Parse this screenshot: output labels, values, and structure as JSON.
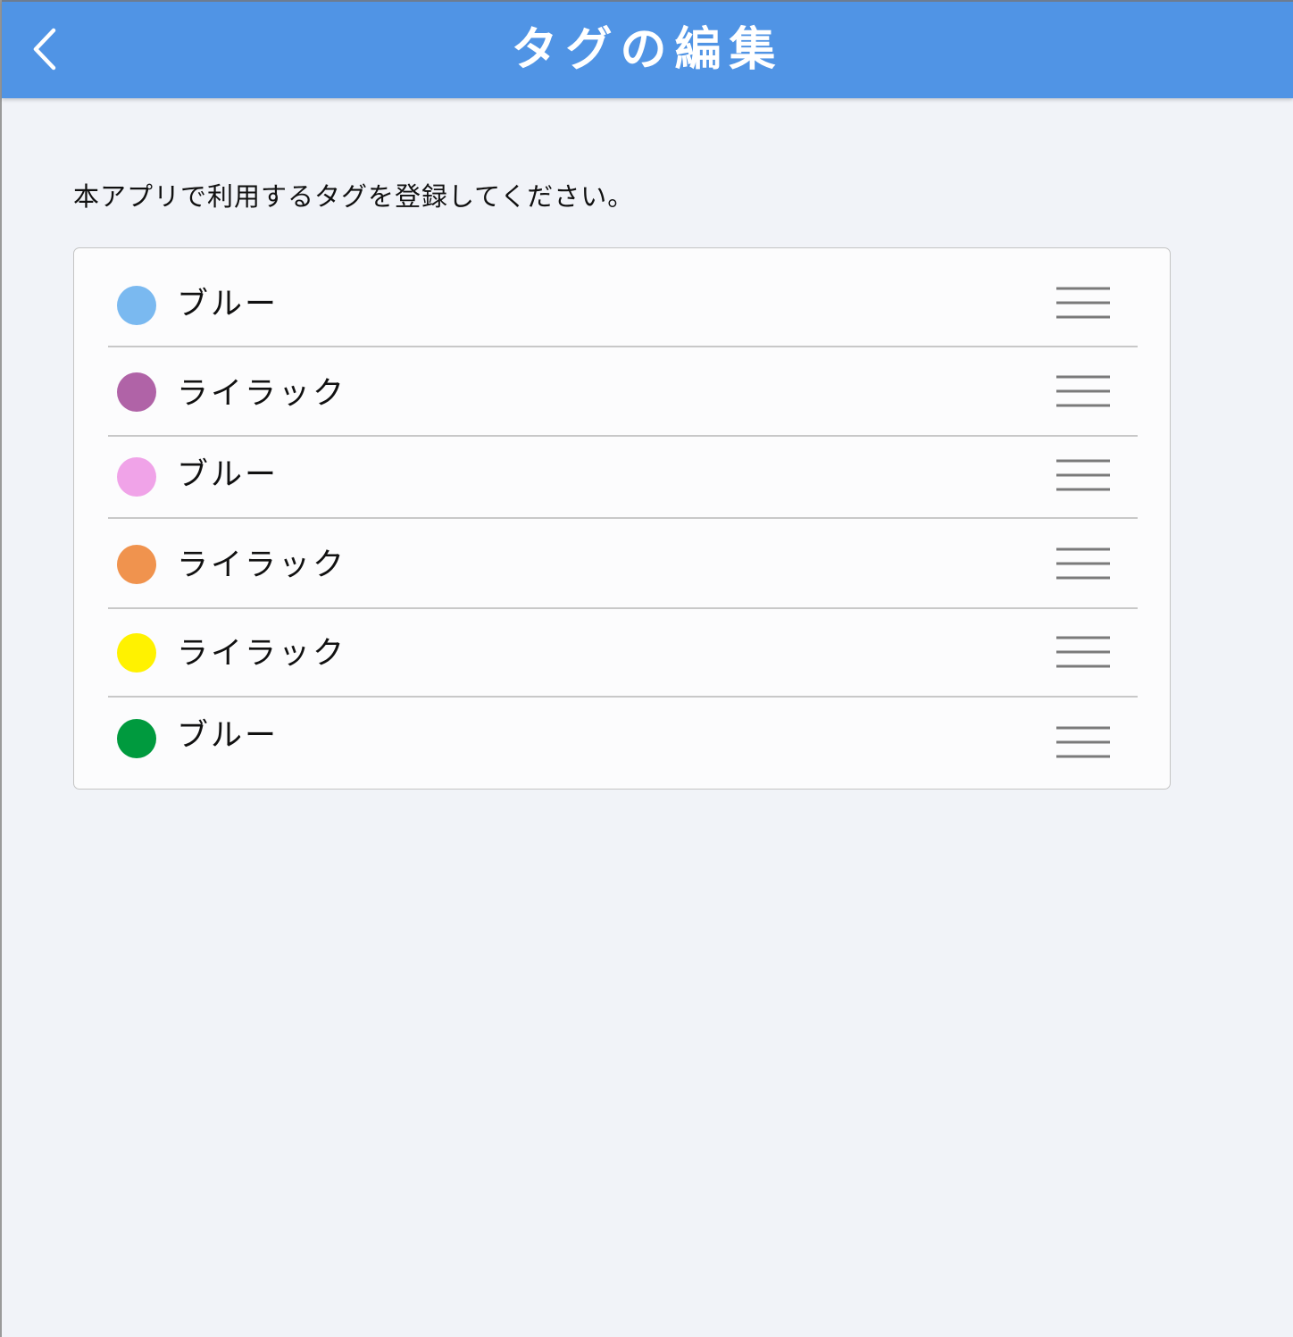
{
  "header": {
    "title": "タグの編集",
    "back_icon": "chevron-left-icon"
  },
  "instruction": "本アプリで利用するタグを登録してください。",
  "tags": [
    {
      "label": "ブルー",
      "color": "#7ab9f0"
    },
    {
      "label": "ライラック",
      "color": "#b063a7"
    },
    {
      "label": "ブルー",
      "color": "#f0a3e8"
    },
    {
      "label": "ライラック",
      "color": "#f0934e"
    },
    {
      "label": "ライラック",
      "color": "#fff200"
    },
    {
      "label": "ブルー",
      "color": "#009a3e"
    }
  ],
  "drag_handle_icon": "drag-handle-icon"
}
